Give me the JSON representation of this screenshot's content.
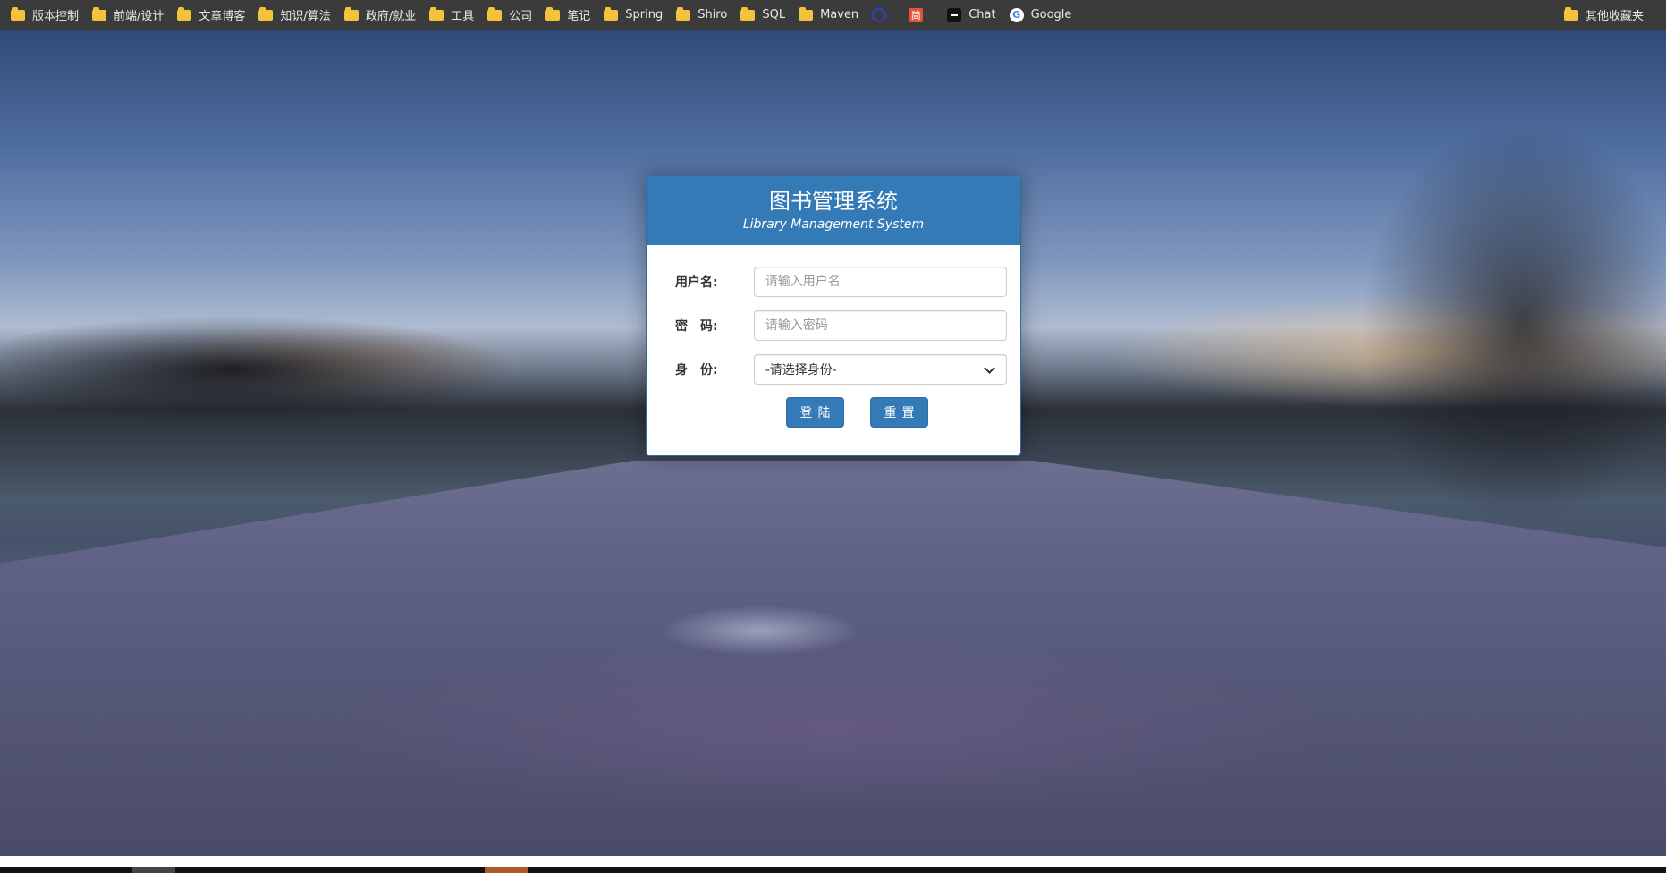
{
  "bookmarks": {
    "items": [
      {
        "label": "版本控制",
        "icon": "folder-icon"
      },
      {
        "label": "前端/设计",
        "icon": "folder-icon"
      },
      {
        "label": "文章博客",
        "icon": "folder-icon"
      },
      {
        "label": "知识/算法",
        "icon": "folder-icon"
      },
      {
        "label": "政府/就业",
        "icon": "folder-icon"
      },
      {
        "label": "工具",
        "icon": "folder-icon"
      },
      {
        "label": "公司",
        "icon": "folder-icon"
      },
      {
        "label": "笔记",
        "icon": "folder-icon"
      },
      {
        "label": "Spring",
        "icon": "folder-icon"
      },
      {
        "label": "Shiro",
        "icon": "folder-icon"
      },
      {
        "label": "SQL",
        "icon": "folder-icon"
      },
      {
        "label": "Maven",
        "icon": "folder-icon"
      }
    ],
    "icon_links": [
      {
        "icon": "globe-icon",
        "label": ""
      },
      {
        "icon": "jian-icon",
        "glyph": "简",
        "label": ""
      },
      {
        "icon": "chat-icon",
        "label": "Chat"
      },
      {
        "icon": "google-icon",
        "glyph": "G",
        "label": "Google"
      }
    ],
    "other": {
      "label": "其他收藏夹",
      "icon": "folder-icon"
    }
  },
  "login": {
    "title": "图书管理系统",
    "subtitle": "Library Management System",
    "username_label": "用户名:",
    "username_placeholder": "请输入用户名",
    "password_label": "密　码:",
    "password_placeholder": "请输入密码",
    "role_label": "身　份:",
    "role_selected": "-请选择身份-",
    "login_button": "登陆",
    "reset_button": "重置"
  },
  "colors": {
    "primary": "#337ab7",
    "bookmark_bar": "#3b3b3b",
    "folder": "#f3c33d"
  }
}
